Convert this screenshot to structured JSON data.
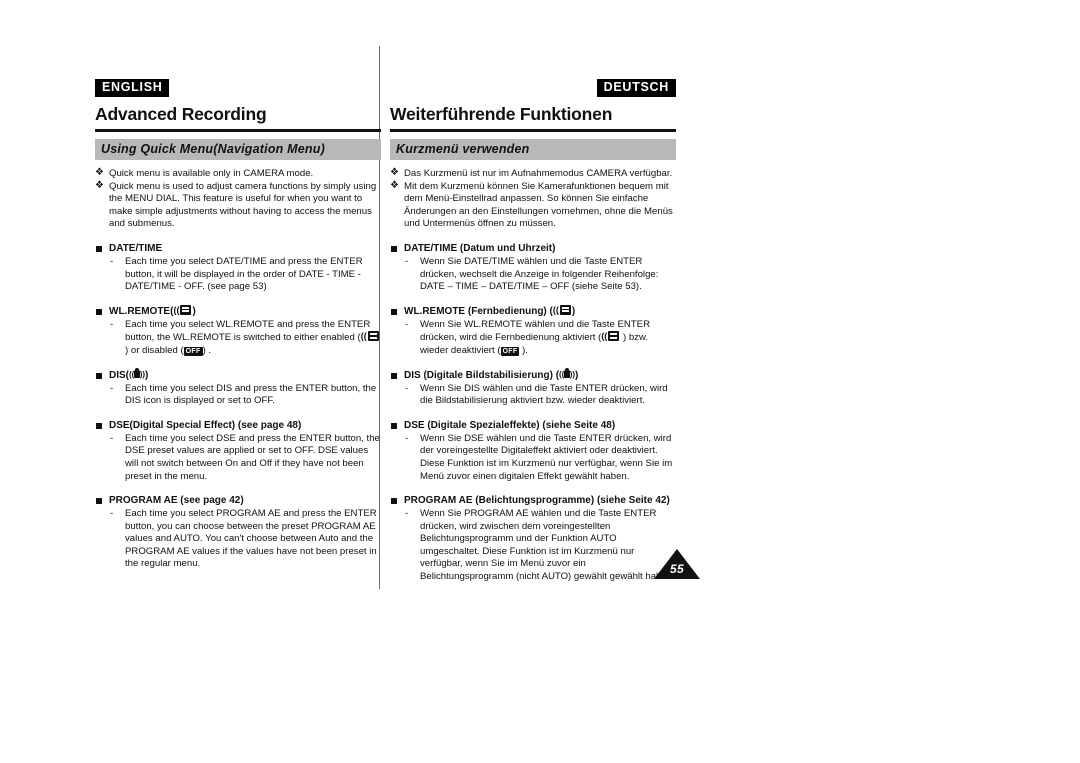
{
  "page": {
    "number": "55"
  },
  "english": {
    "lang_tag": "ENGLISH",
    "chapter_title": "Advanced Recording",
    "section_title": "Using Quick Menu(Navigation Menu)",
    "intro": [
      "Quick menu is available only in CAMERA mode.",
      "Quick menu is used to adjust camera functions by simply using the MENU DIAL. This feature is useful for when you want to make simple adjustments without having to access the menus and submenus."
    ],
    "blocks": [
      {
        "heading": "DATE/TIME",
        "heading_icon": "",
        "body": "Each time you select DATE/TIME and press the ENTER button, it will be displayed in the order of DATE - TIME - DATE/TIME - OFF. (see page 53)"
      },
      {
        "heading": "WL.REMOTE",
        "heading_icon": "remote-icon",
        "body_pre": "Each time you select WL.REMOTE and press the ENTER button, the WL.REMOTE is switched to either enabled (",
        "body_mid": ") or disabled (",
        "body_post": ") .",
        "off_label": "OFF"
      },
      {
        "heading": "DIS",
        "heading_icon": "dis-icon",
        "body": "Each time you select DIS and press the ENTER button, the DIS icon is displayed or set to OFF."
      },
      {
        "heading": "DSE(Digital Special Effect) (see page 48)",
        "heading_icon": "",
        "body": "Each time you select DSE and press the ENTER button, the DSE preset values are applied or set to OFF. DSE values will not switch between On and Off if they have not been preset in the menu."
      },
      {
        "heading": "PROGRAM AE (see page 42)",
        "heading_icon": "",
        "body": "Each time you select PROGRAM AE and press the ENTER button, you can choose between the preset PROGRAM AE values and AUTO. You can't choose between Auto and the PROGRAM AE values if the values have not been preset in the regular menu."
      }
    ]
  },
  "german": {
    "lang_tag": "DEUTSCH",
    "chapter_title": "Weiterführende Funktionen",
    "section_title": "Kurzmenü verwenden",
    "intro": [
      "Das Kurzmenü ist nur im Aufnahmemodus CAMERA verfügbar.",
      "Mit dem Kurzmenü können Sie Kamerafunktionen bequem mit dem Menü-Einstellrad anpassen. So können Sie einfache Änderungen an den Einstellungen vornehmen, ohne die Menüs und Untermenüs öffnen zu müssen."
    ],
    "blocks": [
      {
        "heading": "DATE/TIME (Datum und Uhrzeit)",
        "heading_icon": "",
        "body": "Wenn Sie DATE/TIME wählen und die Taste ENTER drücken, wechselt die Anzeige in folgender Reihenfolge: DATE  – TIME – DATE/TIME  – OFF (siehe Seite 53)."
      },
      {
        "heading": "WL.REMOTE (Fernbedienung)",
        "heading_icon": "remote-icon",
        "body_pre": "Wenn Sie WL.REMOTE wählen und die Taste ENTER drücken, wird die Fernbedienung aktiviert (",
        "body_mid": " ) bzw. wieder deaktiviert (",
        "body_post": " ).",
        "off_label": "OFF"
      },
      {
        "heading": "DIS (Digitale Bildstabilisierung)",
        "heading_icon": "dis-icon",
        "body": "Wenn Sie DIS wählen und die Taste ENTER drücken, wird die Bildstabilisierung aktiviert bzw. wieder deaktiviert."
      },
      {
        "heading": "DSE (Digitale Spezialeffekte) (siehe Seite 48)",
        "heading_icon": "",
        "body": "Wenn Sie DSE wählen und die Taste ENTER drücken, wird der voreingestellte Digitaleffekt aktiviert oder deaktiviert. Diese Funktion ist im Kurzmenü nur verfügbar, wenn Sie im Menü zuvor einen digitalen Effekt gewählt haben."
      },
      {
        "heading": "PROGRAM AE (Belichtungsprogramme) (siehe Seite 42)",
        "heading_icon": "",
        "body": "Wenn Sie PROGRAM AE wählen und die Taste ENTER drücken, wird zwischen dem voreingestellten Belichtungsprogramm und der Funktion AUTO umgeschaltet. Diese Funktion ist im Kurzmenü nur verfügbar, wenn Sie im Menü zuvor ein Belichtungsprogramm (nicht AUTO) gewählt gewählt haben."
      }
    ]
  },
  "symbols": {
    "diamond_bullet": "❖",
    "dash": "-",
    "wave_left": "((",
    "wave_right": "))"
  }
}
